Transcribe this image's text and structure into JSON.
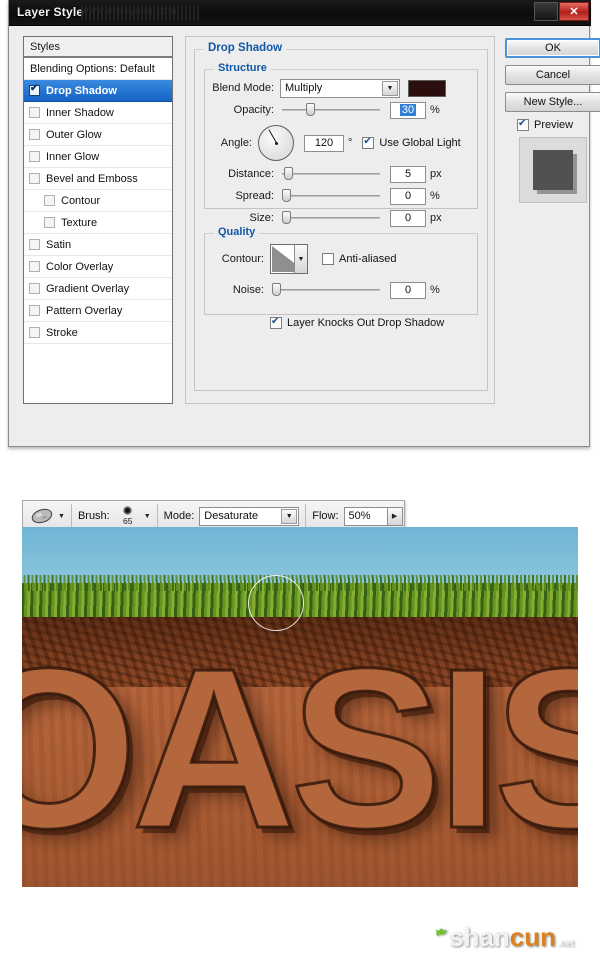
{
  "dialog": {
    "title": "Layer Style",
    "title_watermark": "www.missyuan.com",
    "close_label": "✕",
    "styles_header": "Styles",
    "style_items": [
      {
        "label": "Blending Options: Default",
        "checkbox": "none",
        "checked": false,
        "selected": false,
        "indent": false
      },
      {
        "label": "Drop Shadow",
        "checkbox": "show",
        "checked": true,
        "selected": true,
        "indent": false
      },
      {
        "label": "Inner Shadow",
        "checkbox": "show",
        "checked": false,
        "selected": false,
        "indent": false
      },
      {
        "label": "Outer Glow",
        "checkbox": "show",
        "checked": false,
        "selected": false,
        "indent": false
      },
      {
        "label": "Inner Glow",
        "checkbox": "show",
        "checked": false,
        "selected": false,
        "indent": false
      },
      {
        "label": "Bevel and Emboss",
        "checkbox": "show",
        "checked": false,
        "selected": false,
        "indent": false
      },
      {
        "label": "Contour",
        "checkbox": "show",
        "checked": false,
        "selected": false,
        "indent": true
      },
      {
        "label": "Texture",
        "checkbox": "show",
        "checked": false,
        "selected": false,
        "indent": true
      },
      {
        "label": "Satin",
        "checkbox": "show",
        "checked": false,
        "selected": false,
        "indent": false
      },
      {
        "label": "Color Overlay",
        "checkbox": "show",
        "checked": false,
        "selected": false,
        "indent": false
      },
      {
        "label": "Gradient Overlay",
        "checkbox": "show",
        "checked": false,
        "selected": false,
        "indent": false
      },
      {
        "label": "Pattern Overlay",
        "checkbox": "show",
        "checked": false,
        "selected": false,
        "indent": false
      },
      {
        "label": "Stroke",
        "checkbox": "show",
        "checked": false,
        "selected": false,
        "indent": false
      }
    ],
    "section_title": "Drop Shadow",
    "structure": {
      "group_label": "Structure",
      "blend_mode_label": "Blend Mode:",
      "blend_mode_value": "Multiply",
      "shadow_color": "#2a0f0c",
      "opacity_label": "Opacity:",
      "opacity_value": "30",
      "opacity_unit": "%",
      "angle_label": "Angle:",
      "angle_value": "120",
      "angle_unit": "°",
      "global_light_label": "Use Global Light",
      "global_light_checked": true,
      "distance_label": "Distance:",
      "distance_value": "5",
      "distance_unit": "px",
      "spread_label": "Spread:",
      "spread_value": "0",
      "spread_unit": "%",
      "size_label": "Size:",
      "size_value": "0",
      "size_unit": "px"
    },
    "quality": {
      "group_label": "Quality",
      "contour_label": "Contour:",
      "antialiased_label": "Anti-aliased",
      "antialiased_checked": false,
      "noise_label": "Noise:",
      "noise_value": "0",
      "noise_unit": "%",
      "knockout_label": "Layer Knocks Out Drop Shadow",
      "knockout_checked": true
    },
    "buttons": {
      "ok": "OK",
      "cancel": "Cancel",
      "new_style": "New Style...",
      "preview_label": "Preview",
      "preview_checked": true
    }
  },
  "options_bar": {
    "tool_name": "sponge-tool",
    "brush_label": "Brush:",
    "brush_size": "65",
    "mode_label": "Mode:",
    "mode_value": "Desaturate",
    "flow_label": "Flow:",
    "flow_value": "50%"
  },
  "artwork": {
    "word": "OASIS",
    "logo_shan": "shan",
    "logo_cun": "cun",
    "logo_net": ".net"
  }
}
